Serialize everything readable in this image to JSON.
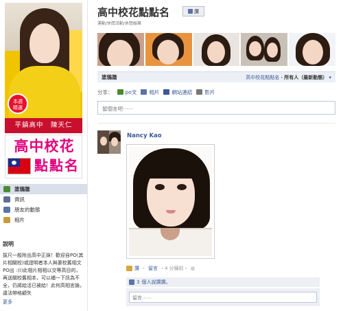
{
  "profile": {
    "badge": "本週\n精選",
    "banner": "平鎮高中　陳天仁"
  },
  "logo": {
    "line1": "高中校花",
    "line2": "點點名"
  },
  "nav": {
    "items": [
      {
        "label": "塗鴉牆",
        "active": true,
        "color": "#4a8a33"
      },
      {
        "label": "資訊",
        "active": false,
        "color": "#5b6f95"
      },
      {
        "label": "朋友的動態",
        "active": false,
        "color": "#5b74a8"
      },
      {
        "label": "相片",
        "active": false,
        "color": "#c89a3a"
      }
    ]
  },
  "about": {
    "title": "說明",
    "text": "拔尺一般附出高中正妹！歡迎自PO(其片相關校)或證明者本人與妻校舊相文PO出  :)))此相片相相以交等高目的，再送關校舊相本，可以補一下訊為不全，仍將給活已被給！此何高相言論，違法帶格顧失",
    "more": "更多"
  },
  "header": {
    "title": "高中校花點點名",
    "like_label": "讚",
    "subtitle": "運動/休閒活動/休閒娛樂"
  },
  "wall": {
    "tab": "塗鴉牆",
    "filter_prefix": "高中校花點點名・",
    "filter_bold": "所有人（最新動態）",
    "share_label": "分享：",
    "actions": [
      {
        "label": "po文",
        "color": "#4a8a33"
      },
      {
        "label": "相片",
        "color": "#5b74a8"
      },
      {
        "label": "網站連結",
        "color": "#3b5998"
      },
      {
        "label": "影片",
        "color": "#777"
      }
    ],
    "status_placeholder": "留個言吧⋯⋯"
  },
  "post": {
    "author": "Nancy Kao",
    "meta_like": "讚",
    "meta_comment": "留言",
    "meta_time": "・4 分鐘前・",
    "likes_count": "3",
    "likes_text": "個人說讚讚。",
    "comment_placeholder": "留言⋯⋯"
  }
}
